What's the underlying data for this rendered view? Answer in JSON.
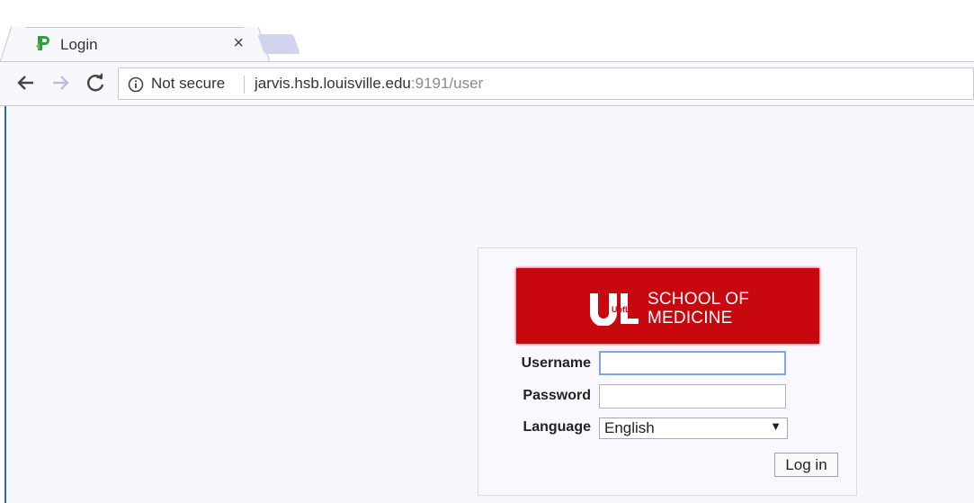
{
  "browser": {
    "tab": {
      "title": "Login",
      "close_glyph": "×",
      "favicon": "green-p-favicon-icon"
    },
    "toolbar": {
      "back_icon": "back-arrow-icon",
      "forward_icon": "forward-arrow-icon",
      "reload_icon": "reload-icon"
    },
    "omnibox": {
      "security_icon": "info-icon",
      "security_text": "Not secure",
      "url_host": "jarvis.hsb.louisville.edu",
      "url_rest": ":9191/user"
    }
  },
  "login": {
    "banner": {
      "logo_text": "UofL",
      "line1": "SCHOOL OF",
      "line2": "MEDICINE",
      "color": "#c8070e"
    },
    "username_label": "Username",
    "username_value": "",
    "password_label": "Password",
    "password_value": "",
    "language_label": "Language",
    "language_selected": "English",
    "language_arrow": "▼",
    "submit_label": "Log in"
  }
}
